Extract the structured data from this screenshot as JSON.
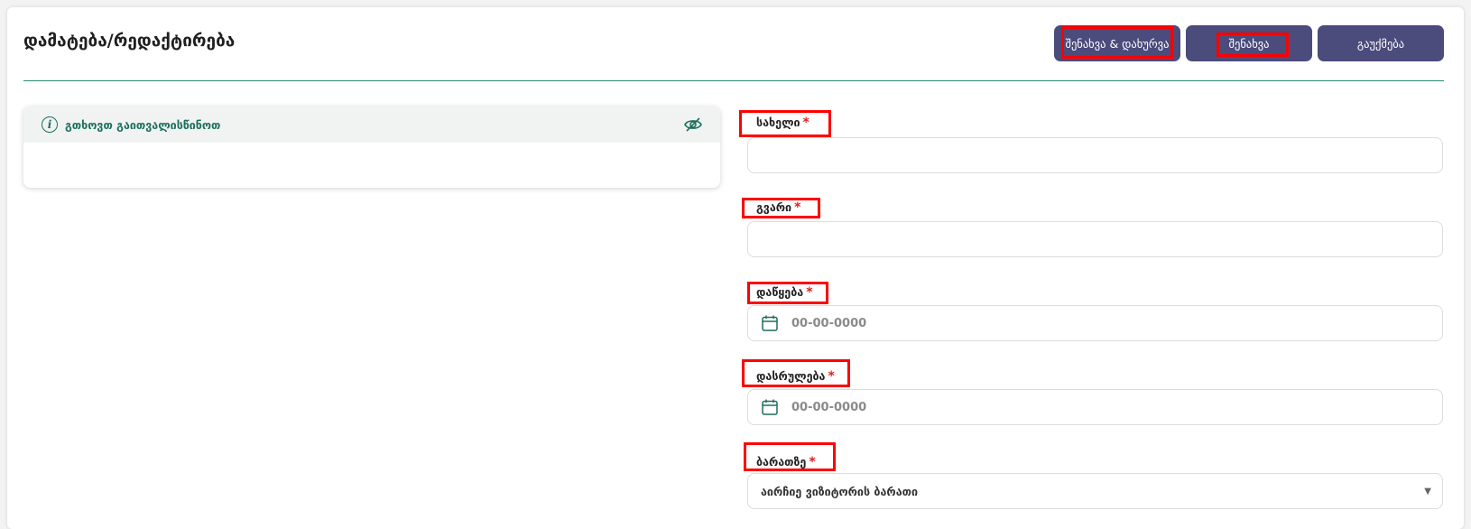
{
  "header": {
    "title": "დამატება/რედაქტირება",
    "buttons": {
      "save_close": "შენახვა & დახურვა",
      "save": "შენახვა",
      "cancel": "გაუქმება"
    }
  },
  "info_panel": {
    "title": "გთხოვთ გაითვალისწინოთ",
    "icons": [
      "info-icon",
      "eye-off-icon"
    ]
  },
  "form": {
    "name_label": "სახელი",
    "surname_label": "გვარი",
    "start_label": "დაწყება",
    "start_placeholder": "00-00-0000",
    "end_label": "დასრულება",
    "end_placeholder": "00-00-0000",
    "card_label": "ბარათზე",
    "card_select_value": "აირჩიე ვიზიტორის ბარათი",
    "required_mark": "*"
  },
  "colors": {
    "button_bg": "#4b4b7c",
    "accent_green": "#1d6f5d",
    "required": "#e02020",
    "highlight": "#ff0000"
  }
}
